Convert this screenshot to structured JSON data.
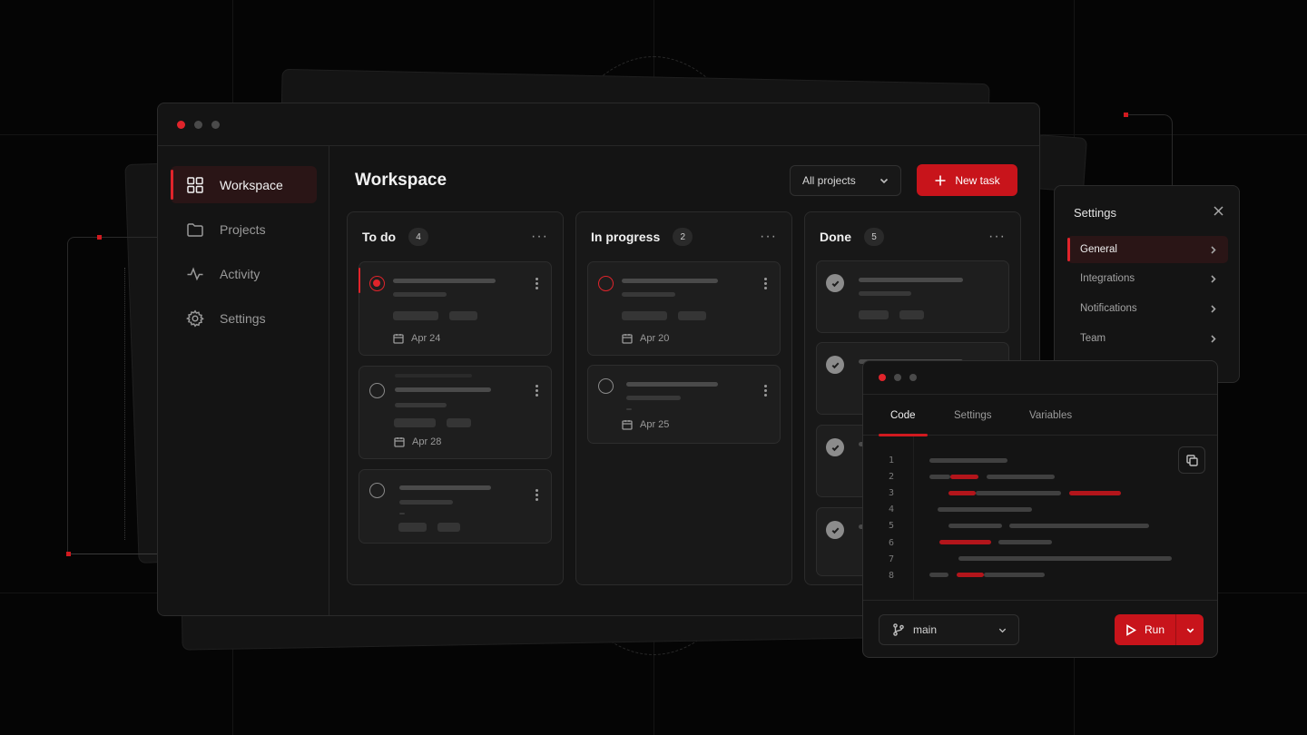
{
  "colors": {
    "accent": "#d11a1f",
    "background": "#050505",
    "panel": "#141414"
  },
  "main_window": {
    "sidebar": {
      "items": [
        {
          "label": "Workspace",
          "icon": "grid-icon",
          "active": true
        },
        {
          "label": "Projects",
          "icon": "folder-icon",
          "active": false
        },
        {
          "label": "Activity",
          "icon": "activity-icon",
          "active": false
        },
        {
          "label": "Settings",
          "icon": "gear-icon",
          "active": false
        }
      ]
    },
    "header": {
      "title": "Workspace",
      "project_filter": "All projects",
      "new_task_label": "New task"
    },
    "columns": [
      {
        "title": "To do",
        "count": "4",
        "cards": [
          {
            "status": "selected",
            "date": "Apr 24"
          },
          {
            "status": "open",
            "date": "Apr 28"
          },
          {
            "status": "open"
          }
        ]
      },
      {
        "title": "In progress",
        "count": "2",
        "cards": [
          {
            "status": "in-progress",
            "date": "Apr 20"
          },
          {
            "status": "open",
            "date": "Apr 25"
          }
        ]
      },
      {
        "title": "Done",
        "count": "5",
        "cards": [
          {
            "status": "done"
          },
          {
            "status": "done"
          },
          {
            "status": "done"
          },
          {
            "status": "done"
          }
        ]
      }
    ]
  },
  "settings_panel": {
    "title": "Settings",
    "items": [
      {
        "label": "General",
        "active": true
      },
      {
        "label": "Integrations",
        "active": false
      },
      {
        "label": "Notifications",
        "active": false
      },
      {
        "label": "Team",
        "active": false
      }
    ]
  },
  "code_window": {
    "tabs": [
      {
        "label": "Code",
        "active": true
      },
      {
        "label": "Settings",
        "active": false
      },
      {
        "label": "Variables",
        "active": false
      }
    ],
    "line_numbers": [
      "1",
      "2",
      "3",
      "4",
      "5",
      "6",
      "7",
      "8"
    ],
    "branch": "main",
    "run_label": "Run"
  }
}
